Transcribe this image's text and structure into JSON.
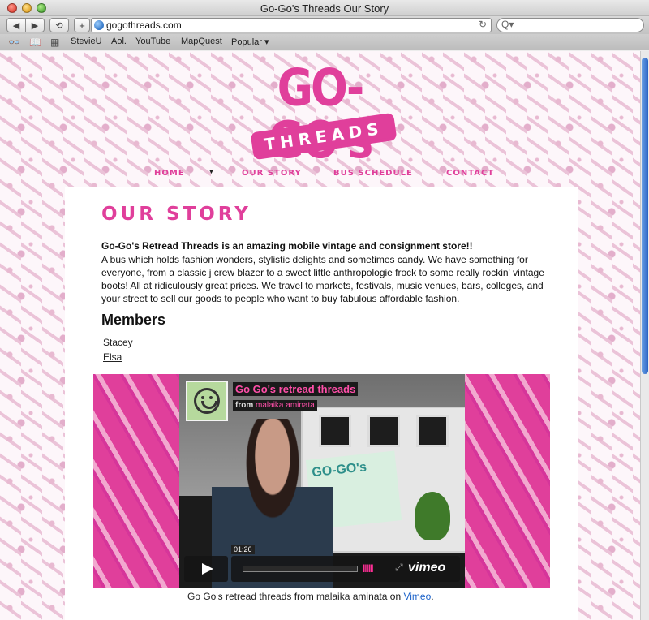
{
  "window": {
    "title": "Go-Go's Threads Our Story"
  },
  "toolbar": {
    "back_icon": "back-arrow-icon",
    "forward_icon": "forward-arrow-icon",
    "add_label": "+",
    "url": "gogothreads.com",
    "reload_glyph": "↻",
    "search_glyph": "Q▾"
  },
  "bookmarks": {
    "items": [
      "StevieU",
      "Aol.",
      "YouTube",
      "MapQuest",
      "Popular ▾"
    ]
  },
  "site": {
    "logo_main": "GO-GO's",
    "logo_sub": "THREADS",
    "nav": [
      "HOME",
      "OUR STORY",
      "BUS SCHEDULE",
      "CONTACT"
    ],
    "nav_caret": "▼",
    "accent_color": "#e03f9b"
  },
  "content": {
    "title": "OUR STORY",
    "intro_bold": "Go-Go's Retread Threads is an amazing mobile vintage and consignment store!!",
    "intro": "A bus which holds fashion wonders, stylistic delights and sometimes candy. We have something for everyone, from a classic j crew blazer to a sweet little anthropologie frock to some really rockin' vintage boots! All at ridiculously great prices. We travel to markets, festivals, music venues, bars, colleges, and your street to sell our goods to people who want to buy fabulous affordable fashion.",
    "members_heading": "Members",
    "members": [
      "Stacey",
      "Elsa"
    ]
  },
  "video": {
    "title": "Go Go's retread threads",
    "from_label": "from",
    "author": "malaika aminata",
    "sign_text": "GO-GO's",
    "timecode": "01:26",
    "volume_glyph": "|||||||",
    "fullscreen_glyph": "⤢",
    "brand": "vimeo",
    "caption": {
      "title_link": "Go Go's retread threads",
      "from": "from",
      "author_link": "malaika aminata",
      "on": "on",
      "site_link": "Vimeo",
      "end": "."
    }
  }
}
